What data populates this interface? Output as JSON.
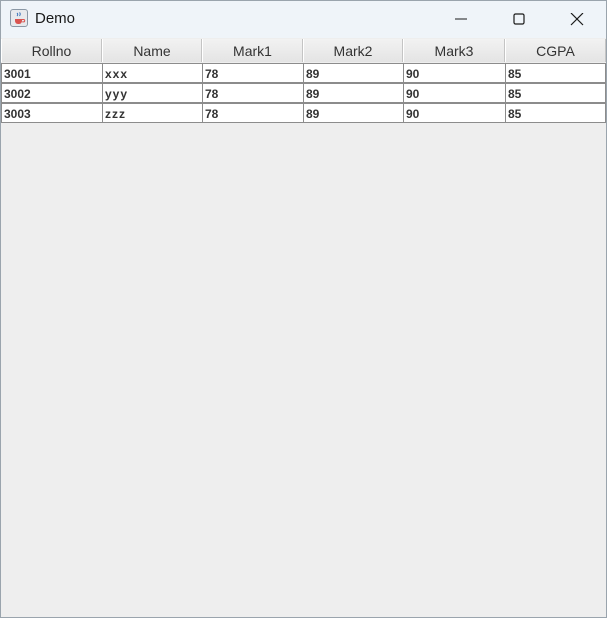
{
  "window": {
    "title": "Demo",
    "icon": "java-cup-icon"
  },
  "table": {
    "columns": [
      "Rollno",
      "Name",
      "Mark1",
      "Mark2",
      "Mark3",
      "CGPA"
    ],
    "rows": [
      [
        "3001",
        "xxx",
        "78",
        "89",
        "90",
        "85"
      ],
      [
        "3002",
        "yyy",
        "78",
        "89",
        "90",
        "85"
      ],
      [
        "3003",
        "zzz",
        "78",
        "89",
        "90",
        "85"
      ]
    ]
  },
  "colors": {
    "titlebar": "#eff4f9",
    "background": "#eeeeee",
    "grid": "#8c8c8c"
  }
}
